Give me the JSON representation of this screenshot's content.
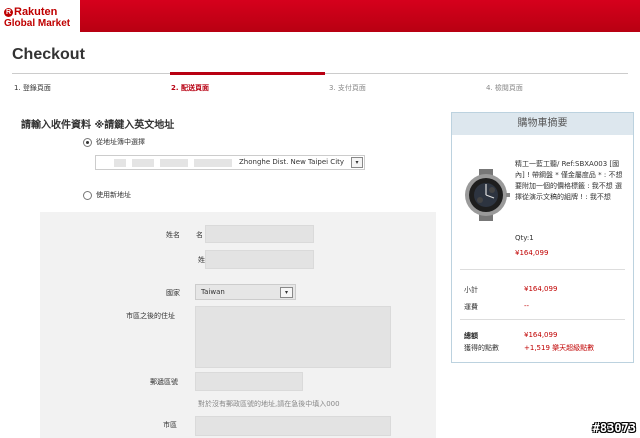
{
  "header": {
    "logo_line1": "Rakuten",
    "logo_line2": "Global Market",
    "brand_color": "#bf0000"
  },
  "page_title": "Checkout",
  "steps": [
    {
      "label": "1. 登錄頁面",
      "active": false
    },
    {
      "label": "2. 配送頁面",
      "active": true
    },
    {
      "label": "3. 支付頁面",
      "active": false
    },
    {
      "label": "4. 檢閱頁面",
      "active": false
    }
  ],
  "shipping": {
    "section_title": "請輸入收件資料 ※請鍵入英文地址",
    "option_existing": "從地址簿中選擇",
    "option_new": "使用新地址",
    "existing_address_selected": "Zhonghe Dist. New Taipei City",
    "select_arrow": "▾"
  },
  "form": {
    "name_label": "姓名",
    "first_name_label": "名",
    "last_name_label": "姓",
    "country_label": "國家",
    "country_value": "Taiwan",
    "address_label": "市區之後的住址",
    "postal_label": "郵遞區號",
    "postal_hint": "對於沒有郵政區號的地址,請在急後中填入000",
    "city_label": "市區"
  },
  "summary": {
    "heading": "購物車摘要",
    "product_name": "精工一藍工聽/ Ref:SBXA003 [國內] ! 帶鋼盤 * 僅金屬度品 * : 不想 要附加一個的價格標籤 : 我不想 選擇從演示文稿的組牌 ! : 我不想",
    "quantity": "Qty:1",
    "item_price": "¥164,099",
    "subtotal_label": "小計",
    "subtotal_value": "¥164,099",
    "shipping_label": "運費",
    "shipping_value": "--",
    "total_label": "總額",
    "total_value": "¥164,099",
    "points_label": "獲得的點數",
    "points_value": "+1,519 樂天超級點數"
  },
  "watermark": "#83073"
}
